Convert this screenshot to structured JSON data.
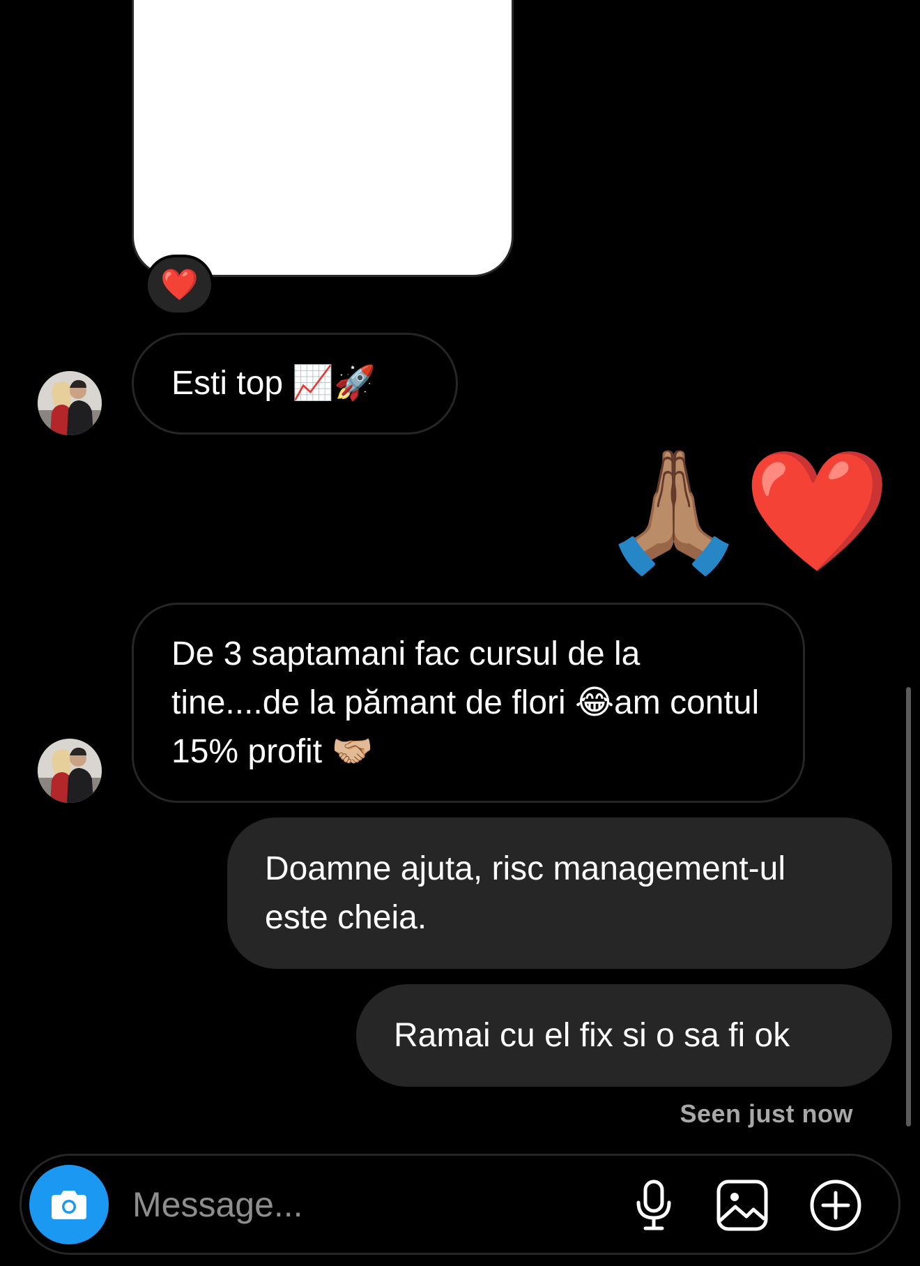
{
  "conversation": {
    "reaction_emoji": "❤️",
    "messages": [
      {
        "from": "them",
        "text": "Esti top 📈🚀"
      },
      {
        "from": "me",
        "text": "🙏🏽❤️"
      },
      {
        "from": "them",
        "text": "De 3 saptamani fac cursul de la tine....de la pămant de flori 😂am contul 15% profit 🤝🏼"
      },
      {
        "from": "me",
        "text": "Doamne ajuta, risc management-ul este cheia."
      },
      {
        "from": "me",
        "text": "Ramai cu el fix si o sa fi ok"
      }
    ],
    "seen_status": "Seen just now"
  },
  "composer": {
    "placeholder": "Message...",
    "value": "",
    "icons": [
      "camera-icon",
      "microphone-icon",
      "gallery-icon",
      "plus-icon"
    ]
  },
  "colors": {
    "background": "#000000",
    "incoming_bubble_border": "#262626",
    "outgoing_bubble": "#262626",
    "camera_button": "#1a98f2",
    "seen_text": "#a8a8a8",
    "placeholder": "#8e8e8e"
  }
}
